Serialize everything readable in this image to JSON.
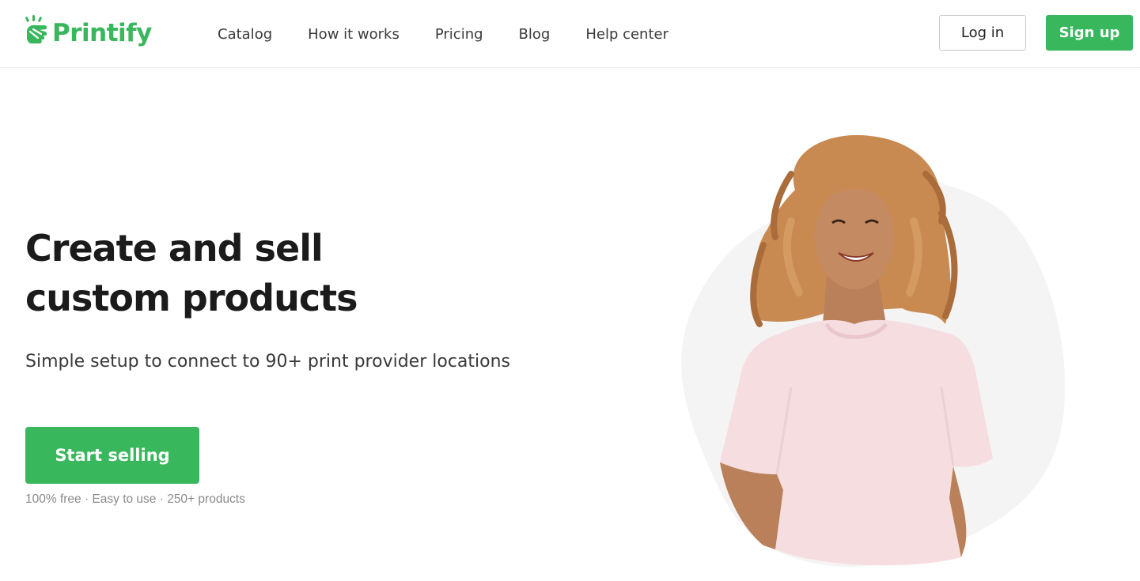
{
  "brand": {
    "name": "Printify",
    "logo_icon": "hand-printify-logo-icon",
    "color": "#39b75d"
  },
  "nav": {
    "items": [
      {
        "label": "Catalog"
      },
      {
        "label": "How it works"
      },
      {
        "label": "Pricing"
      },
      {
        "label": "Blog"
      },
      {
        "label": "Help center"
      }
    ]
  },
  "auth": {
    "login_label": "Log in",
    "signup_label": "Sign up"
  },
  "hero": {
    "title_line1": "Create and sell",
    "title_line2": "custom products",
    "subtitle": "Simple setup to connect to 90+ print provider locations",
    "cta_label": "Start selling",
    "features": "100% free · Easy to use  · 250+ products",
    "image": "woman-in-pink-tshirt-photo",
    "accent_color": "#39b75d",
    "blob_color": "#f4f4f4"
  }
}
